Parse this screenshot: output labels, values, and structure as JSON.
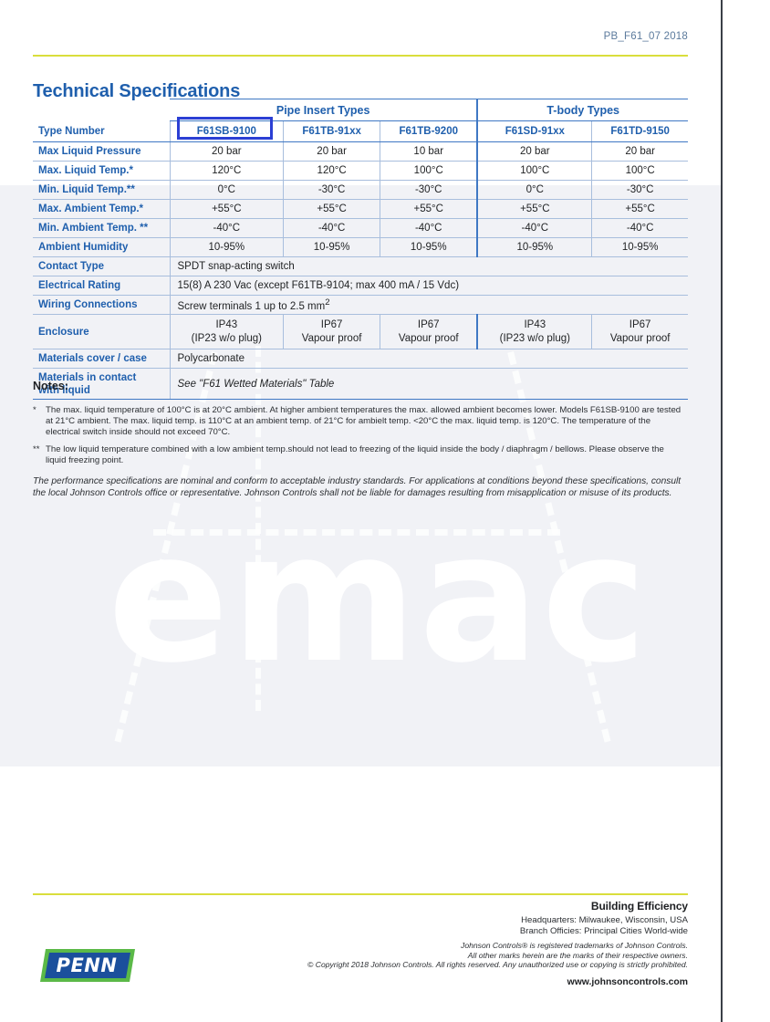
{
  "header": {
    "doc_code": "PB_F61_07 2018",
    "rule_color": "#d9de3c"
  },
  "page_title": "Technical Specifications",
  "theme": {
    "accent_blue": "#1f5fad",
    "table_border_blue": "#3f78c4",
    "light_border": "#a8bedd",
    "highlight_blue": "#2b3fd4",
    "band_grey": "#f1f2f6",
    "yellow_rule": "#d9de3c",
    "logo_blue": "#1b4f9c",
    "logo_green": "#5bb948"
  },
  "watermark": {
    "text": "emac"
  },
  "spec_table": {
    "group_headers": [
      {
        "label": "Pipe Insert Types",
        "span": 3
      },
      {
        "label": "T-body Types",
        "span": 2
      }
    ],
    "type_row_label": "Type Number",
    "type_numbers": [
      "F61SB-9100",
      "F61TB-91xx",
      "F61TB-9200",
      "F61SD-91xx",
      "F61TD-9150"
    ],
    "highlighted_type": "F61SB-9100",
    "rows": [
      {
        "label": "Max Liquid Pressure",
        "values": [
          "20 bar",
          "20 bar",
          "10 bar",
          "20 bar",
          "20 bar"
        ]
      },
      {
        "label": "Max. Liquid Temp.*",
        "values": [
          "120°C",
          "120°C",
          "100°C",
          "100°C",
          "100°C"
        ]
      },
      {
        "label": "Min. Liquid Temp.**",
        "values": [
          "0°C",
          "-30°C",
          "-30°C",
          "0°C",
          "-30°C"
        ]
      },
      {
        "label": "Max. Ambient Temp.*",
        "values": [
          "+55°C",
          "+55°C",
          "+55°C",
          "+55°C",
          "+55°C"
        ]
      },
      {
        "label": "Min. Ambient Temp. **",
        "values": [
          "-40°C",
          "-40°C",
          "-40°C",
          "-40°C",
          "-40°C"
        ]
      },
      {
        "label": "Ambient Humidity",
        "values": [
          "10-95%",
          "10-95%",
          "10-95%",
          "10-95%",
          "10-95%"
        ]
      }
    ],
    "contact_type": {
      "label": "Contact Type",
      "value": "SPDT snap-acting switch"
    },
    "electrical_rating": {
      "label": "Electrical Rating",
      "value": "15(8) A 230 Vac (except F61TB-9104; max 400 mA / 15 Vdc)"
    },
    "wiring_connections": {
      "label": "Wiring Connections",
      "value_prefix": "Screw terminals 1 up to 2.5 mm",
      "value_sup": "2"
    },
    "enclosure": {
      "label": "Enclosure",
      "cells": [
        {
          "line1": "IP43",
          "line2": "(IP23 w/o plug)"
        },
        {
          "line1": "IP67",
          "line2": "Vapour proof"
        },
        {
          "line1": "IP67",
          "line2": "Vapour proof"
        },
        {
          "line1": "IP43",
          "line2": "(IP23 w/o plug)"
        },
        {
          "line1": "IP67",
          "line2": "Vapour proof"
        }
      ]
    },
    "materials_cover": {
      "label": "Materials cover / case",
      "value": "Polycarbonate"
    },
    "materials_liquid": {
      "label_line1": "Materials in contact",
      "label_line2": "with liquid",
      "value": "See \"F61 Wetted Materials\" Table"
    }
  },
  "notes": {
    "heading": "Notes:",
    "items": [
      {
        "mark": "*",
        "text": "The max. liquid temperature of 100°C is at 20°C ambient. At higher ambient temperatures the max. allowed ambient becomes lower. Models F61SB-9100 are tested at 21°C ambient. The max. liquid temp. is 110°C at an ambient temp. of 21°C for ambielt temp. <20°C the max. liquid temp. is 120°C. The temperature of the electrical switch inside should not exceed 70°C."
      },
      {
        "mark": "**",
        "text": "The low liquid temperature combined with a low ambient temp.should not lead to freezing of the liquid inside the body / diaphragm / bellows. Please observe the liquid freezing point."
      }
    ],
    "disclaimer": "The performance specifications are nominal and conform to acceptable industry standards. For applications at conditions beyond these specifications, consult the local Johnson Controls office or representative. Johnson Controls shall not be liable for damages resulting from misapplication or misuse of its products."
  },
  "footer": {
    "building_efficiency": "Building Efficiency",
    "headquarters": "Headquarters: Milwaukee, Wisconsin, USA",
    "branch_offices": "Branch Officies: Principal Cities World-wide",
    "legal_line1": "Johnson Controls® is registered trademarks of Johnson Controls.",
    "legal_line2": "All other marks herein are the marks of their respective owners.",
    "legal_line3": "© Copyright 2018 Johnson Controls. All rights reserved. Any unauthorized use or copying is strictly prohibited.",
    "url": "www.johnsoncontrols.com",
    "logo_text": "PENN"
  }
}
